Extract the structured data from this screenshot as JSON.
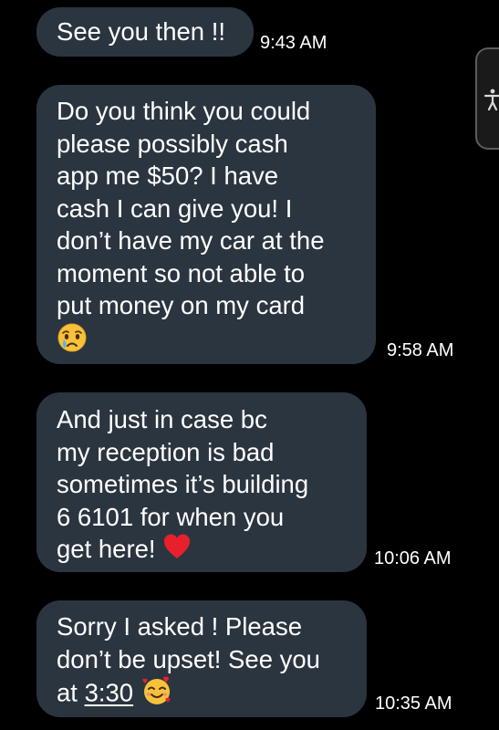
{
  "messages": [
    {
      "lines": [
        "See you then !!"
      ],
      "time": "9:43 AM"
    },
    {
      "lines": [
        "Do you think you could",
        "please possibly cash",
        "app me $50? I have",
        "cash I can give you! I",
        "don’t have my car at the",
        "moment so not able to",
        "put money on my card"
      ],
      "emoji": "crying-face",
      "time": "9:58 AM"
    },
    {
      "lines": [
        "And just in case bc",
        "my reception is bad",
        "sometimes it’s building",
        "6 6101 for when you",
        "get here!"
      ],
      "emoji": "red-heart",
      "time": "10:06 AM"
    },
    {
      "lines": [
        "Sorry I asked ! Please",
        "don’t be upset! See you",
        "at "
      ],
      "link": "3:30",
      "emoji": "smiling-face-with-hearts",
      "time": "10:35 AM"
    }
  ],
  "colors": {
    "background": "#000000",
    "bubble": "#2b3540",
    "text": "#ffffff"
  },
  "icons": {
    "side_tab": "accessibility-icon"
  }
}
